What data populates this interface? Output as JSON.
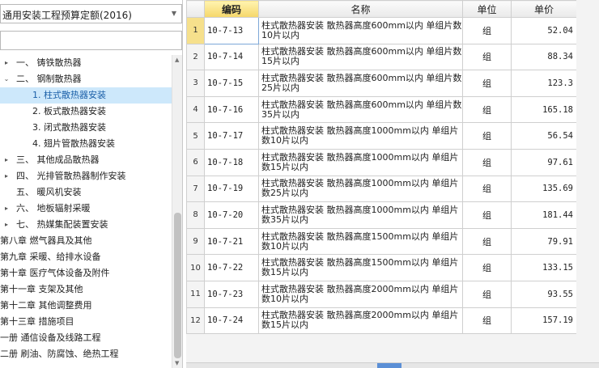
{
  "quota_select": {
    "value": "通用安装工程预算定额(2016)"
  },
  "search": {
    "value": "",
    "placeholder": ""
  },
  "tree": [
    {
      "label": "一、 铸铁散热器",
      "level": 1,
      "toggle": "right"
    },
    {
      "label": "二、 钢制散热器",
      "level": 1,
      "toggle": "down"
    },
    {
      "label": "1. 柱式散热器安装",
      "level": 2,
      "selected": true
    },
    {
      "label": "2. 板式散热器安装",
      "level": 2
    },
    {
      "label": "3. 闭式散热器安装",
      "level": 2
    },
    {
      "label": "4. 翅片管散热器安装",
      "level": 2
    },
    {
      "label": "三、 其他成品散热器",
      "level": 1,
      "toggle": "right"
    },
    {
      "label": "四、 光排管散热器制作安装",
      "level": 1,
      "toggle": "right"
    },
    {
      "label": "五、 暖风机安装",
      "level": 1
    },
    {
      "label": "六、 地板辐射采暖",
      "level": 1,
      "toggle": "right"
    },
    {
      "label": "七、 热媒集配装置安装",
      "level": 1,
      "toggle": "right"
    },
    {
      "label": "第八章 燃气器具及其他",
      "level": 0
    },
    {
      "label": "第九章 采暖、给排水设备",
      "level": 0
    },
    {
      "label": "第十章 医疗气体设备及附件",
      "level": 0
    },
    {
      "label": "第十一章 支架及其他",
      "level": 0
    },
    {
      "label": "第十二章 其他调整费用",
      "level": 0
    },
    {
      "label": "第十三章 措施项目",
      "level": 0
    },
    {
      "label": "一册 通信设备及线路工程",
      "level": 0
    },
    {
      "label": "二册 刷油、防腐蚀、绝热工程",
      "level": 0
    }
  ],
  "grid": {
    "headers": {
      "index": "",
      "code": "编码",
      "name": "名称",
      "unit": "单位",
      "price": "单价"
    },
    "rows": [
      {
        "index": "1",
        "code": "10-7-13",
        "name": "柱式散热器安装 散热器高度600mm以内 单组片数10片以内",
        "unit": "组",
        "price": "52.04"
      },
      {
        "index": "2",
        "code": "10-7-14",
        "name": "柱式散热器安装 散热器高度600mm以内 单组片数15片以内",
        "unit": "组",
        "price": "88.34"
      },
      {
        "index": "3",
        "code": "10-7-15",
        "name": "柱式散热器安装 散热器高度600mm以内 单组片数25片以内",
        "unit": "组",
        "price": "123.3"
      },
      {
        "index": "4",
        "code": "10-7-16",
        "name": "柱式散热器安装 散热器高度600mm以内 单组片数35片以内",
        "unit": "组",
        "price": "165.18"
      },
      {
        "index": "5",
        "code": "10-7-17",
        "name": "柱式散热器安装 散热器高度1000mm以内 单组片数10片以内",
        "unit": "组",
        "price": "56.54"
      },
      {
        "index": "6",
        "code": "10-7-18",
        "name": "柱式散热器安装 散热器高度1000mm以内 单组片数15片以内",
        "unit": "组",
        "price": "97.61"
      },
      {
        "index": "7",
        "code": "10-7-19",
        "name": "柱式散热器安装 散热器高度1000mm以内 单组片数25片以内",
        "unit": "组",
        "price": "135.69"
      },
      {
        "index": "8",
        "code": "10-7-20",
        "name": "柱式散热器安装 散热器高度1000mm以内 单组片数35片以内",
        "unit": "组",
        "price": "181.44"
      },
      {
        "index": "9",
        "code": "10-7-21",
        "name": "柱式散热器安装 散热器高度1500mm以内 单组片数10片以内",
        "unit": "组",
        "price": "79.91"
      },
      {
        "index": "10",
        "code": "10-7-22",
        "name": "柱式散热器安装 散热器高度1500mm以内 单组片数15片以内",
        "unit": "组",
        "price": "133.15"
      },
      {
        "index": "11",
        "code": "10-7-23",
        "name": "柱式散热器安装 散热器高度2000mm以内 单组片数10片以内",
        "unit": "组",
        "price": "93.55"
      },
      {
        "index": "12",
        "code": "10-7-24",
        "name": "柱式散热器安装 散热器高度2000mm以内 单组片数15片以内",
        "unit": "组",
        "price": "157.19"
      }
    ]
  }
}
